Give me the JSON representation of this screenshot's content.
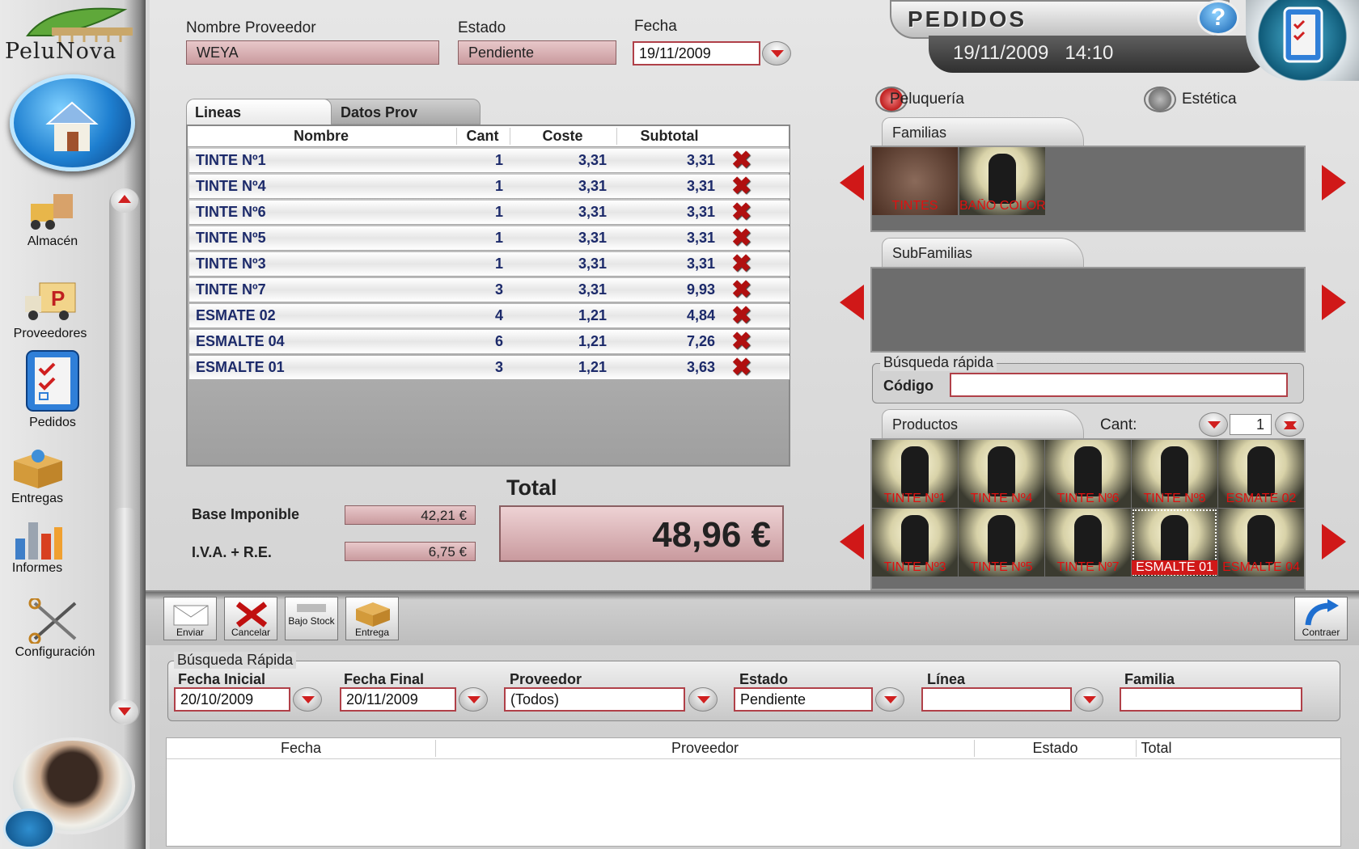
{
  "sidebar": {
    "logo": "PeluNova",
    "nav": [
      {
        "label": "Almacén",
        "icon": "forklift-icon"
      },
      {
        "label": "Proveedores",
        "icon": "truck-icon"
      },
      {
        "label": "Pedidos",
        "icon": "checklist-icon"
      },
      {
        "label": "Entregas",
        "icon": "box-icon"
      },
      {
        "label": "Informes",
        "icon": "bar-chart-icon"
      },
      {
        "label": "Configuración",
        "icon": "scissors-icon"
      }
    ]
  },
  "header": {
    "title": "PEDIDOS",
    "datetime": "19/11/2009   14:10",
    "help": "?"
  },
  "form": {
    "proveedor_label": "Nombre Proveedor",
    "proveedor_value": "WEYA",
    "estado_label": "Estado",
    "estado_value": "Pendiente",
    "fecha_label": "Fecha",
    "fecha_value": "19/11/2009"
  },
  "tabs": [
    {
      "label": "Lineas",
      "active": true
    },
    {
      "label": "Datos Prov",
      "active": false
    }
  ],
  "grid": {
    "columns": [
      "Nombre",
      "Cant",
      "Coste",
      "Subtotal"
    ],
    "rows": [
      {
        "nombre": "TINTE Nº1",
        "cant": "1",
        "coste": "3,31",
        "subtotal": "3,31"
      },
      {
        "nombre": "TINTE Nº4",
        "cant": "1",
        "coste": "3,31",
        "subtotal": "3,31"
      },
      {
        "nombre": "TINTE Nº6",
        "cant": "1",
        "coste": "3,31",
        "subtotal": "3,31"
      },
      {
        "nombre": "TINTE Nº5",
        "cant": "1",
        "coste": "3,31",
        "subtotal": "3,31"
      },
      {
        "nombre": "TINTE Nº3",
        "cant": "1",
        "coste": "3,31",
        "subtotal": "3,31"
      },
      {
        "nombre": "TINTE Nº7",
        "cant": "3",
        "coste": "3,31",
        "subtotal": "9,93"
      },
      {
        "nombre": "ESMATE 02",
        "cant": "4",
        "coste": "1,21",
        "subtotal": "4,84"
      },
      {
        "nombre": "ESMALTE 04",
        "cant": "6",
        "coste": "1,21",
        "subtotal": "7,26"
      },
      {
        "nombre": "ESMALTE 01",
        "cant": "3",
        "coste": "1,21",
        "subtotal": "3,63"
      }
    ]
  },
  "totals": {
    "base_label": "Base Imponible",
    "base_value": "42,21 €",
    "iva_label": "I.V.A. + R.E.",
    "iva_value": "6,75 €",
    "total_label": "Total",
    "total_value": "48,96 €"
  },
  "catalog": {
    "radio_peluqueria": "Peluquería",
    "radio_estetica": "Estética",
    "familias_label": "Familias",
    "familias": [
      "TINTES",
      "BAÑO COLOR"
    ],
    "subfamilias_label": "SubFamilias",
    "busqueda_label": "Búsqueda rápida",
    "codigo_label": "Código",
    "codigo_value": "",
    "productos_label": "Productos",
    "cant_label": "Cant:",
    "cant_value": "1",
    "productos": [
      "TINTE Nº1",
      "TINTE Nº4",
      "TINTE Nº6",
      "TINTE Nº8",
      "ESMATE 02",
      "TINTE Nº3",
      "TINTE Nº5",
      "TINTE Nº7",
      "ESMALTE 01",
      "ESMALTE 04"
    ],
    "selected_product": "ESMALTE 01"
  },
  "toolbar": {
    "enviar": "Enviar",
    "cancelar": "Cancelar",
    "bajo_stock": "Bajo Stock",
    "entrega": "Entrega",
    "contraer": "Contraer"
  },
  "search": {
    "group_label": "Búsqueda Rápida",
    "fecha_inicial_label": "Fecha Inicial",
    "fecha_inicial_value": "20/10/2009",
    "fecha_final_label": "Fecha Final",
    "fecha_final_value": "20/11/2009",
    "proveedor_label": "Proveedor",
    "proveedor_value": "(Todos)",
    "estado_label": "Estado",
    "estado_value": "Pendiente",
    "linea_label": "Línea",
    "linea_value": "",
    "familia_label": "Familia",
    "familia_value": ""
  },
  "results": {
    "columns": [
      "Fecha",
      "Proveedor",
      "Estado",
      "Total"
    ]
  },
  "colors": {
    "accent_red": "#d01818",
    "pink_field": "#d9b0b3",
    "grid_text": "#1c2a6a"
  }
}
